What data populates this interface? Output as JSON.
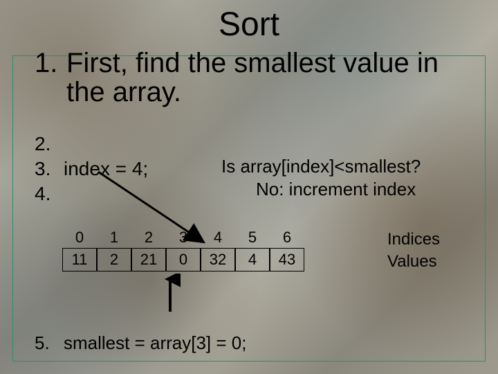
{
  "title": "Sort",
  "step1": {
    "num": "1.",
    "text": "First, find the smallest value in the array."
  },
  "step2": {
    "num": "2.",
    "text": ""
  },
  "step3": {
    "num": "3.",
    "text": "index = 4;"
  },
  "step4": {
    "num": "4.",
    "text": ""
  },
  "question": {
    "line1": "Is array[index]<smallest?",
    "line2": "No: increment index"
  },
  "indices": [
    "0",
    "1",
    "2",
    "3",
    "4",
    "5",
    "6"
  ],
  "values": [
    "11",
    "2",
    "21",
    "0",
    "32",
    "4",
    "43"
  ],
  "label_indices": "Indices",
  "label_values": "Values",
  "step5": {
    "num": "5.",
    "text": "smallest = array[3] = 0;"
  }
}
